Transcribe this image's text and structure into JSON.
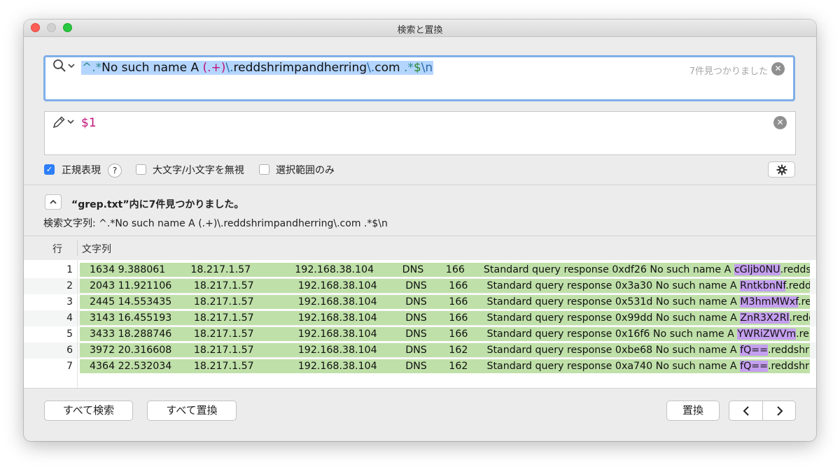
{
  "window": {
    "title": "検索と置換"
  },
  "find": {
    "prefix": "^.*",
    "part1": "No such name A ",
    "group": "(.+)",
    "esc1": "\\.",
    "part2": "reddshrimpandherring",
    "esc2": "\\.",
    "part3": "com ",
    "tail": ".*",
    "anchor": "$",
    "newline": "\\n",
    "count_label": "7件見つかりました"
  },
  "replace": {
    "value": "$1"
  },
  "options": {
    "regex": {
      "label": "正規表現",
      "checked": true
    },
    "help": "?",
    "ignore_case": {
      "label": "大文字/小文字を無視",
      "checked": false
    },
    "selection_only": {
      "label": "選択範囲のみ",
      "checked": false
    }
  },
  "results": {
    "summary": "“grep.txt”内に7件見つかりました。",
    "query_label": "検索文字列: ^.*No such name A (.+)\\.reddshrimpandherring\\.com .*$\\n",
    "columns": {
      "line": "行",
      "text": "文字列"
    },
    "rows": [
      {
        "line": "1",
        "pre": "1634 9.388061        18.217.1.57              192.168.38.104         DNS       166      Standard query response 0xdf26 No such name A ",
        "cap": "cGljb0NU",
        "post": ".redds..."
      },
      {
        "line": "2",
        "pre": "2043 11.921106       18.217.1.57              192.168.38.104         DNS       166      Standard query response 0x3a30 No such name A ",
        "cap": "RntkbnNf",
        "post": ".redds..."
      },
      {
        "line": "3",
        "pre": "2445 14.553435       18.217.1.57              192.168.38.104         DNS       166      Standard query response 0x531d No such name A ",
        "cap": "M3hmMWxf",
        "post": ".re..."
      },
      {
        "line": "4",
        "pre": "3143 16.455193       18.217.1.57              192.168.38.104         DNS       166      Standard query response 0x99dd No such name A ",
        "cap": "ZnR3X2Rl",
        "post": ".redd..."
      },
      {
        "line": "5",
        "pre": "3433 18.288746       18.217.1.57              192.168.38.104         DNS       166      Standard query response 0x16f6 No such name A ",
        "cap": "YWRiZWVm",
        "post": ".re..."
      },
      {
        "line": "6",
        "pre": "3972 20.316608       18.217.1.57              192.168.38.104         DNS       162      Standard query response 0xbe68 No such name A ",
        "cap": "fQ==",
        "post": ".reddshri..."
      },
      {
        "line": "7",
        "pre": "4364 22.532034       18.217.1.57              192.168.38.104         DNS       162      Standard query response 0xa740 No such name A ",
        "cap": "fQ==",
        "post": ".reddshri..."
      }
    ]
  },
  "buttons": {
    "find_all": "すべて検索",
    "replace_all": "すべて置換",
    "replace": "置換",
    "prev": "‹",
    "next": "›"
  },
  "icons": {
    "search": "magnifier-icon",
    "pencil": "pencil-icon",
    "clear": "clear-icon",
    "gear": "gear-icon"
  },
  "colors": {
    "match_bg": "#bfe0a8",
    "capture_bg": "#c59ff0",
    "focus_ring": "#80aee8",
    "regex_group": "#c0137a"
  }
}
